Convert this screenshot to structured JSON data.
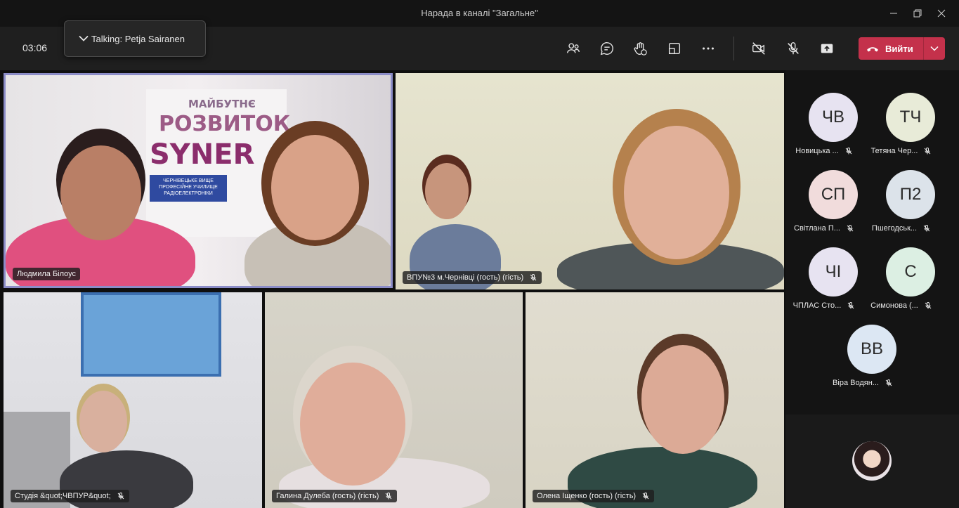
{
  "window": {
    "title": "Нарада в каналі \"Загальне\""
  },
  "toolbar": {
    "timer": "03:06",
    "talking": "Talking: Petja Sairanen",
    "leave_label": "Вийти"
  },
  "tiles": [
    {
      "name": "Людмила Білоус",
      "muted": false
    },
    {
      "name": "ВПУ№3 м.Чернівці (гость) (гість)",
      "muted": true
    },
    {
      "name": "Студія &quot;ЧВПУР&quot;",
      "muted": true
    },
    {
      "name": "Галина Дулеба (гость) (гість)",
      "muted": true
    },
    {
      "name": "Олена Іщенко (гость) (гість)",
      "muted": true
    }
  ],
  "poster": {
    "line1": "МАЙБУТНЄ",
    "line2": "РОЗВИТОК",
    "line3": "SYNER",
    "sign": "ЧЕРНІВЕЦЬКЕ ВИЩЕ ПРОФЕСІЙНЕ УЧИЛИЩЕ РАДІОЕЛЕКТРОНІКИ"
  },
  "roster": [
    {
      "initials": "ЧВ",
      "name": "Новицька ...",
      "color": "#e7e3f1"
    },
    {
      "initials": "ТЧ",
      "name": "Тетяна Чер...",
      "color": "#e8ebd8"
    },
    {
      "initials": "СП",
      "name": "Світлана П...",
      "color": "#f1dcdc"
    },
    {
      "initials": "П2",
      "name": "Пшегодськ...",
      "color": "#dce3ea"
    },
    {
      "initials": "ЧІ",
      "name": "ЧПЛАС Сто...",
      "color": "#e7e3f1"
    },
    {
      "initials": "С",
      "name": "Симонова (...",
      "color": "#dcefe3"
    },
    {
      "initials": "ВВ",
      "name": "Віра Водян...",
      "color": "#dce7f3"
    }
  ]
}
